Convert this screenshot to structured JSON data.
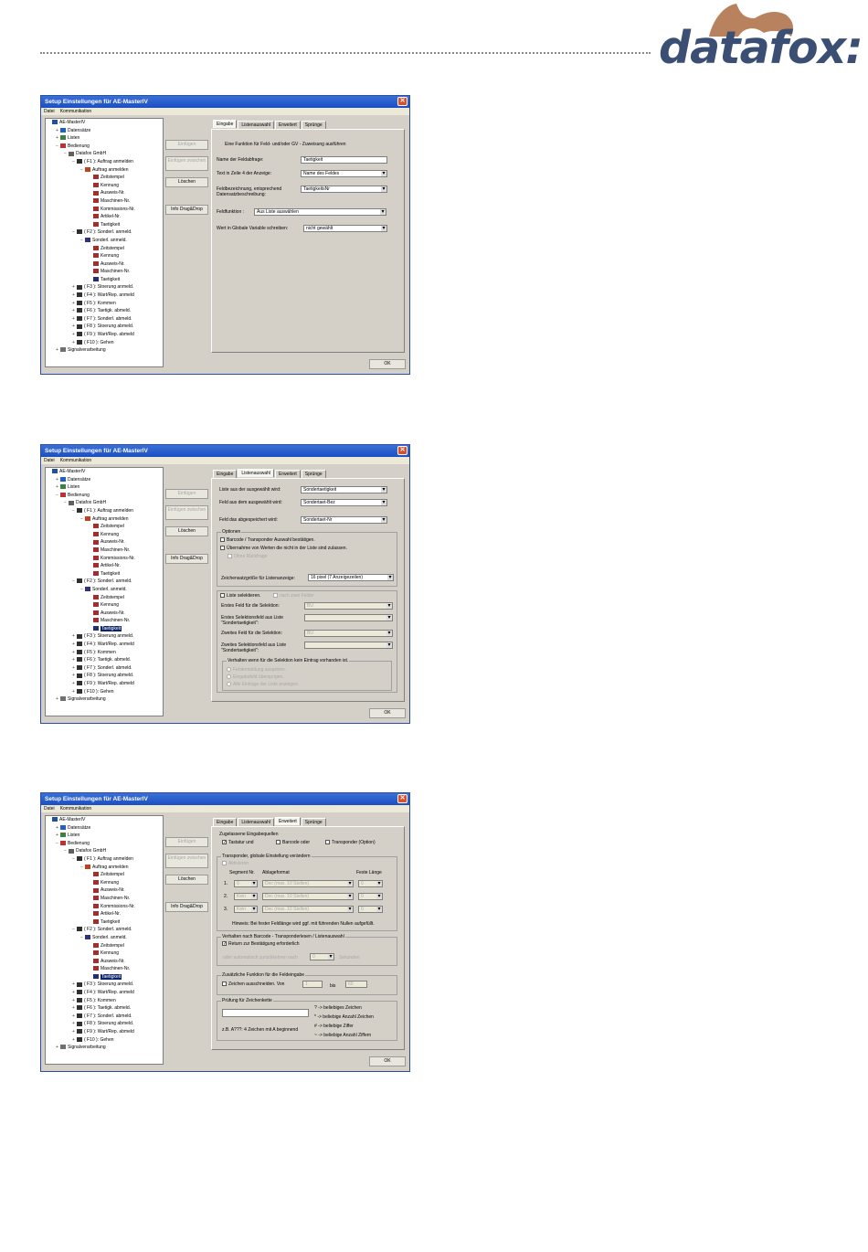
{
  "header": {
    "logo_text": "datafox:"
  },
  "tree_items": [
    "AE-MasterIV",
    "Datensätze",
    "Listen",
    "Bedienung",
    "Datafox GmbH",
    "( F1 ): Auftrag anmelden",
    "Auftrag anmelden",
    "Zeitstempel",
    "Kennung",
    "Ausweis-Nr.",
    "Maschinen-Nr.",
    "Kommissions-Nr.",
    "Artikel-Nr.",
    "Taetigkeit",
    "( F2 ): Sonderl. anmeld.",
    "Sonderl. anmeld.",
    "Zeitstempel",
    "Kennung",
    "Ausweis-Nr.",
    "Maschinen-Nr.",
    "Taetigkeit",
    "( F3 ): Stoerung anmeld.",
    "( F4 ): Wart/Rep. anmeld",
    "( F5 ): Kommen",
    "( F6 ): Taetigk. abmeld.",
    "( F7 ): Sonderl. abmeld.",
    "( F8 ): Stoerung abmeld.",
    "( F9 ): Wart/Rep. abmeld",
    "( F10 ): Gehen",
    "Signalverarbeitung"
  ],
  "dialog": {
    "title": "Setup Einstellungen für AE-MasterIV",
    "menu": [
      "Datei",
      "Kommunikation"
    ],
    "buttons": {
      "einfuegen": "Einfügen",
      "einfuegen_zwischen": "Einfügen zwischen",
      "loeschen": "Löschen",
      "info": "Info Drag&Drop",
      "ok": "OK"
    },
    "tabs": [
      "Eingabe",
      "Listenauswahl",
      "Erweitert",
      "Sprünge"
    ]
  },
  "win1": {
    "desc": "Eine Funktion für Feld- und/oder GV - Zuweisung ausführen",
    "rows": [
      {
        "label": "Name der Feldabfrage:",
        "value": "Taetigkeit"
      },
      {
        "label": "Text in Zeile 4 der Anzeige:",
        "value": "Name des Feldes"
      },
      {
        "label": "Feldbezeichnung, entsprechend Datensatzbeschreibung:",
        "value": "TaetigkeitsNr"
      },
      {
        "label": "Feldfunktion :",
        "value": "Aus Liste auswählen"
      },
      {
        "label": "Wert in Globale Variable schreiben:",
        "value": "nicht gewählt"
      }
    ]
  },
  "win2": {
    "rows": [
      {
        "label": "Liste aus der ausgewählt wird:",
        "value": "Sondertaetigkeit"
      },
      {
        "label": "Feld aus dem ausgewählt wird:",
        "value": "Sondertaet-Bez"
      },
      {
        "label": "Feld das abgespeichert wird:",
        "value": "Sondertaet-Nr"
      }
    ],
    "optionen_title": "Optionen",
    "opt1": "Barcode / Transponder Auswahl bestätigen.",
    "opt2": "Übernahme von Werten die nicht in der Liste sind zulassen.",
    "opt3": "Ohne Rückfrage",
    "font_label": "Zeichensatzgröße für Listenanzeige:",
    "font_value": "16 pixel (7 Anzeigezeilen)",
    "liste_sel": "Liste selektieren.",
    "nach_zwei": "nach zwei Felder",
    "sel_rows": [
      {
        "label": "Erstes Feld für die Selektion:",
        "value": "BU"
      },
      {
        "label": "Erstes Selektionsfeld aus Liste \"Sondertaetigkeit\":",
        "value": ""
      },
      {
        "label": "Zweites Feld für die Selektion:",
        "value": "BU"
      },
      {
        "label": "Zweites Selektionsfeld aus Liste \"Sondertaetigkeit\":",
        "value": ""
      }
    ],
    "verhalten": "Verhalten wenn für die Selektion kein Eintrag vorhanden ist.",
    "radios": [
      "Fehlermeldung ausgeben.",
      "Eingabefeld übersprigen.",
      "Alle Einträge der Liste anzeigen."
    ]
  },
  "win3": {
    "zugelassen": "Zugelassene Eingabequellen",
    "src": [
      "Tastatur und",
      "Barcode oder",
      "Transponder (Option)"
    ],
    "transponder_title": "Transponder, globale Einstellung verändern",
    "aktivieren": "Aktivieren",
    "cols": [
      "Segment Nr.",
      "Ablageformat",
      "Feste Länge"
    ],
    "seg_rows": [
      {
        "n": "1.",
        "seg": "0",
        "fmt": "Dec (max. 10 Stellen)",
        "len": "0"
      },
      {
        "n": "2.",
        "seg": "Kein",
        "fmt": "Dec (max. 10 Stellen)",
        "len": "0"
      },
      {
        "n": "3.",
        "seg": "Kein",
        "fmt": "Dec (max. 10 Stellen)",
        "len": "0"
      }
    ],
    "hinweis": "Hinweis: Bei fester Feldlänge wird ggf. mit führenden Nullen aufgefüllt.",
    "verhalten_title": "Verhalten nach Barcode - Transponderlesen / Listenauswahl",
    "return": "Return zur Bestätigung erforderlich",
    "auto": "oder automatisch zurückkehren nach",
    "auto_value": "0",
    "sekunden": "Sekunden",
    "zus_title": "Zusätzliche Funktion für die Feldeingabe",
    "zeichen": "Zeichen ausschneiden. Von",
    "von": "1",
    "bis_label": "bis",
    "bis": "60",
    "pruef_title": "Prüfung für Zeichenkette",
    "legend": [
      "? -> beliebiges Zeichen",
      "* -> beliebige Anzahl Zeichen",
      "# -> beliebige Ziffer",
      "~ -> beliebige Anzahl Ziffern"
    ],
    "beispiel": "z.B. A???: 4 Zeichen mit A beginnend"
  }
}
